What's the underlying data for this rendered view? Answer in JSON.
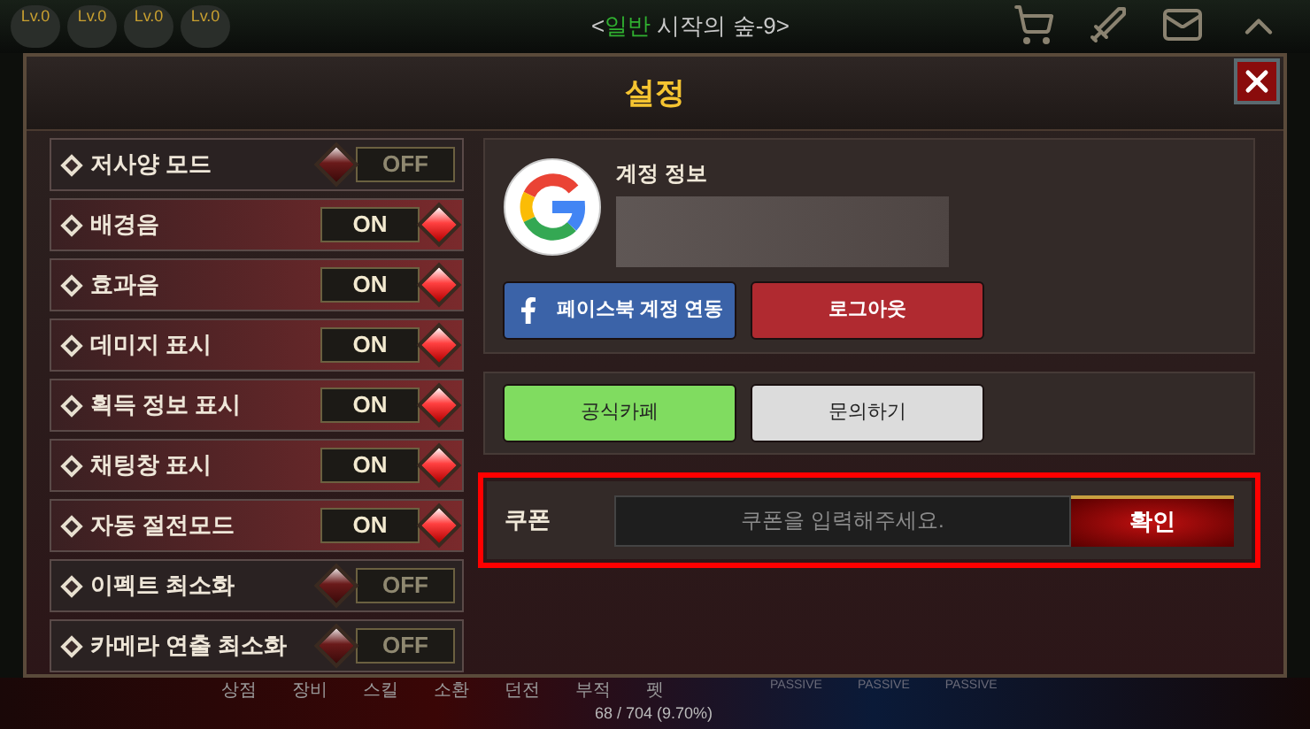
{
  "top_bar": {
    "level_badges": [
      "Lv.0",
      "Lv.0",
      "Lv.0",
      "Lv.0"
    ],
    "location": {
      "open": "<",
      "tag": "일반",
      "name": "시작의 숲-9",
      "close": ">"
    }
  },
  "dialog": {
    "title": "설정"
  },
  "settings": [
    {
      "label": "저사양 모드",
      "on": false,
      "state_label": "OFF"
    },
    {
      "label": "배경음",
      "on": true,
      "state_label": "ON"
    },
    {
      "label": "효과음",
      "on": true,
      "state_label": "ON"
    },
    {
      "label": "데미지 표시",
      "on": true,
      "state_label": "ON"
    },
    {
      "label": "획득 정보 표시",
      "on": true,
      "state_label": "ON"
    },
    {
      "label": "채팅창 표시",
      "on": true,
      "state_label": "ON"
    },
    {
      "label": "자동 절전모드",
      "on": true,
      "state_label": "ON"
    },
    {
      "label": "이펙트 최소화",
      "on": false,
      "state_label": "OFF"
    },
    {
      "label": "카메라 연출 최소화",
      "on": false,
      "state_label": "OFF"
    }
  ],
  "account": {
    "heading": "계정 정보",
    "buttons": [
      "페이스북 계정 연동",
      "로그아웃"
    ]
  },
  "links": [
    "공식카페",
    "문의하기"
  ],
  "coupon": {
    "label": "쿠폰",
    "placeholder": "쿠폰을 입력해주세요.",
    "button": "확인"
  },
  "bottom_bar": {
    "tabs": [
      "상점",
      "장비",
      "스킬",
      "소환",
      "던전",
      "부적",
      "펫"
    ],
    "skills": [
      "PASSIVE",
      "PASSIVE",
      "PASSIVE"
    ],
    "exp": "68 / 704 (9.70%)"
  }
}
